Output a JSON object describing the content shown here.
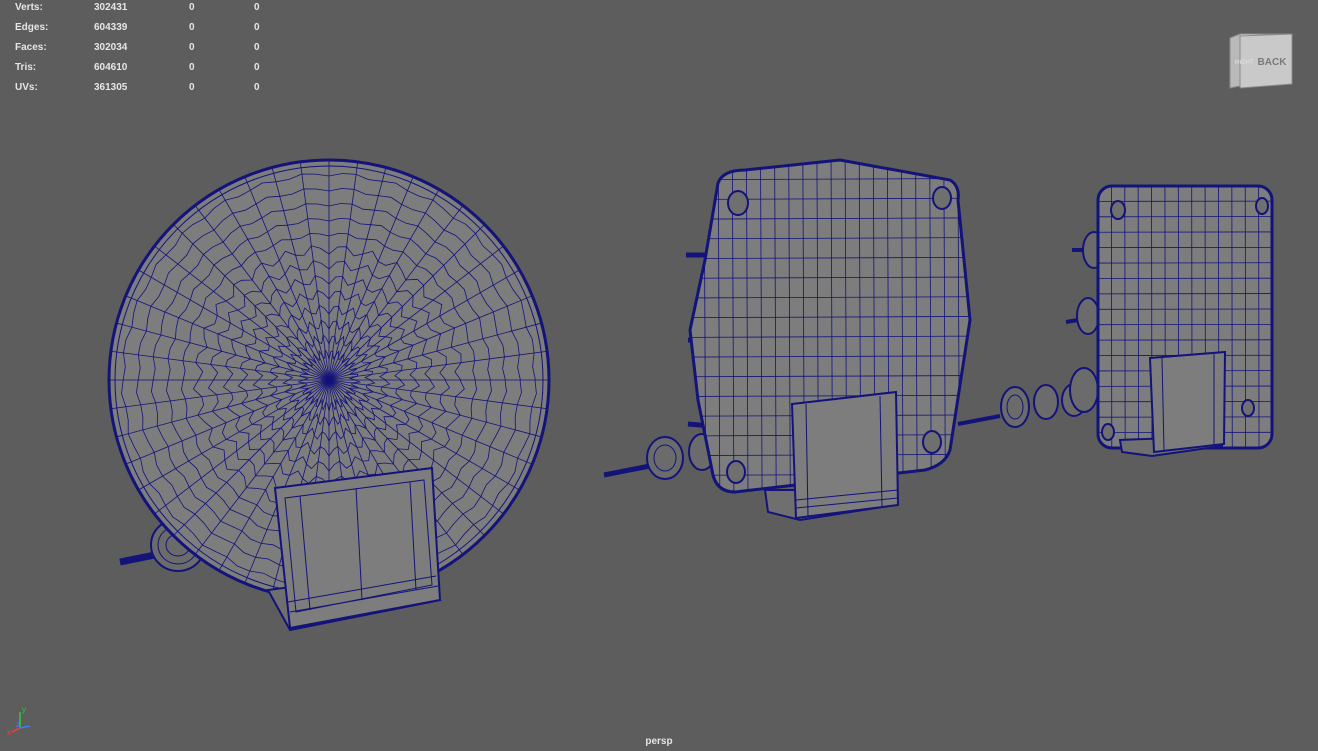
{
  "heads_up_display": {
    "rows": [
      {
        "label": "Verts:",
        "values": [
          "302431",
          "0",
          "0"
        ]
      },
      {
        "label": "Edges:",
        "values": [
          "604339",
          "0",
          "0"
        ]
      },
      {
        "label": "Faces:",
        "values": [
          "302034",
          "0",
          "0"
        ]
      },
      {
        "label": "Tris:",
        "values": [
          "604610",
          "0",
          "0"
        ]
      },
      {
        "label": "UVs:",
        "values": [
          "361305",
          "0",
          "0"
        ]
      }
    ]
  },
  "viewcube": {
    "front_label": "BACK",
    "side_label": "RIGHT"
  },
  "camera": {
    "name": "persp"
  },
  "axis_gizmo": {
    "y": "y",
    "z": "z",
    "x": "x"
  },
  "colors": {
    "background": "#5d5d5d",
    "wireframe": "#13137a",
    "mesh_fill": "#7d7d7d",
    "hud_text": "#e6e6e6"
  }
}
